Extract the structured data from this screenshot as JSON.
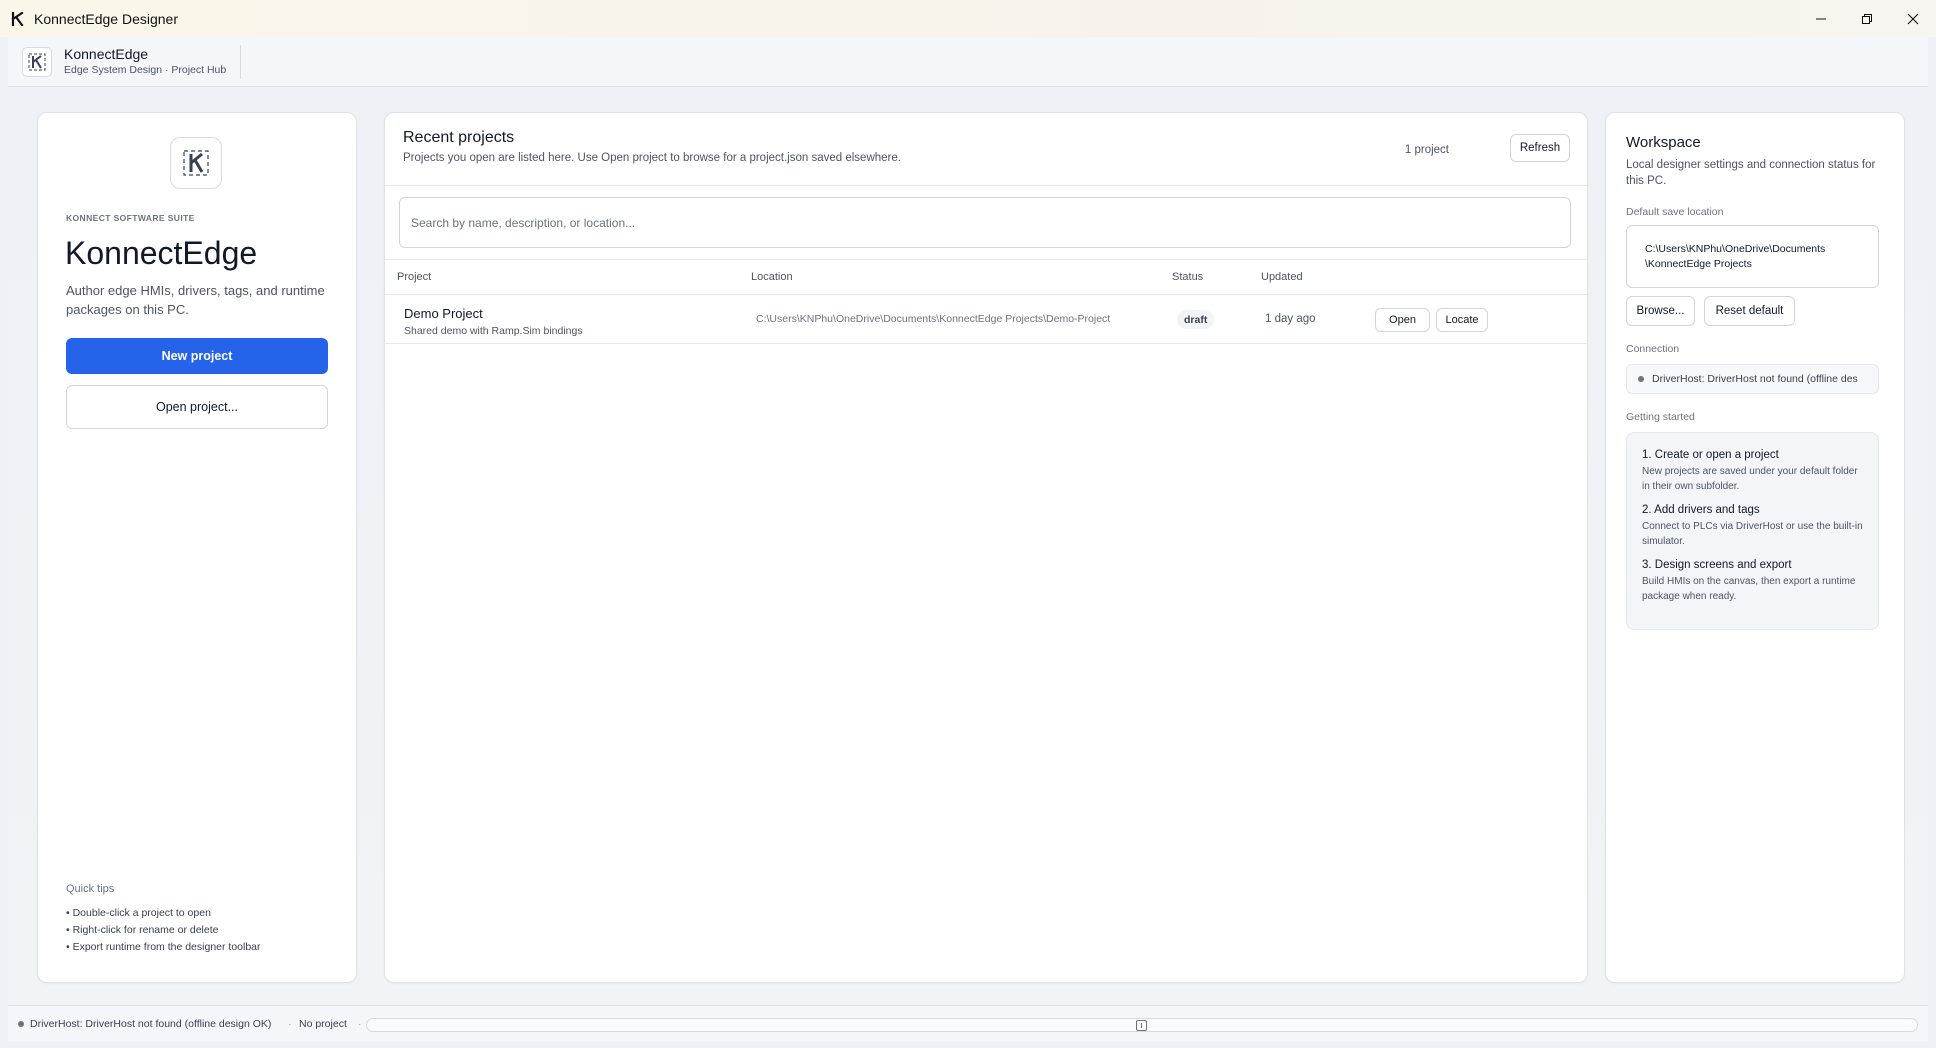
{
  "window": {
    "title": "KonnectEdge Designer"
  },
  "header": {
    "brand_name": "KonnectEdge",
    "brand_sub": "Edge System Design · Project Hub"
  },
  "left": {
    "suite_label": "KONNECT SOFTWARE SUITE",
    "hero_title": "KonnectEdge",
    "hero_desc": "Author edge HMIs, drivers, tags, and runtime packages on this PC.",
    "new_project_label": "New project",
    "open_project_label": "Open project...",
    "tips_title": "Quick tips",
    "tips": [
      "• Double-click a project to open",
      "• Right-click for rename or delete",
      "• Export runtime from the designer toolbar"
    ]
  },
  "center": {
    "title": "Recent projects",
    "subtitle": "Projects you open are listed here. Use Open project to browse for a project.json saved elsewhere.",
    "count": "1 project",
    "refresh_label": "Refresh",
    "search_placeholder": "Search by name, description, or location...",
    "columns": [
      "Project",
      "Location",
      "Status",
      "Updated"
    ],
    "rows": [
      {
        "name": "Demo Project",
        "desc": "Shared demo with Ramp.Sim bindings",
        "location": "C:\\Users\\KNPhu\\OneDrive\\Documents\\KonnectEdge Projects\\Demo-Project",
        "status": "draft",
        "updated": "1 day ago",
        "open_label": "Open",
        "locate_label": "Locate"
      }
    ]
  },
  "workspace": {
    "title": "Workspace",
    "desc": "Local designer settings and connection status for this PC.",
    "save_location_label": "Default save location",
    "save_path_line1": "C:\\Users\\KNPhu\\OneDrive\\Documents",
    "save_path_line2": "\\KonnectEdge Projects",
    "browse_label": "Browse...",
    "reset_label": "Reset default",
    "connection_label": "Connection",
    "connection_status": "DriverHost: DriverHost not found (offline des",
    "getting_started_label": "Getting started",
    "steps": [
      {
        "title": "1. Create or open a project",
        "desc": "New projects are saved under your default folder in their own subfolder."
      },
      {
        "title": "2. Add drivers and tags",
        "desc": "Connect to PLCs via DriverHost or use the built-in simulator."
      },
      {
        "title": "3. Design screens and export",
        "desc": "Build HMIs on the canvas, then export a runtime package when ready."
      }
    ]
  },
  "statusbar": {
    "connection": "DriverHost: DriverHost not found (offline design OK)",
    "separator": "·",
    "project": "No project"
  }
}
